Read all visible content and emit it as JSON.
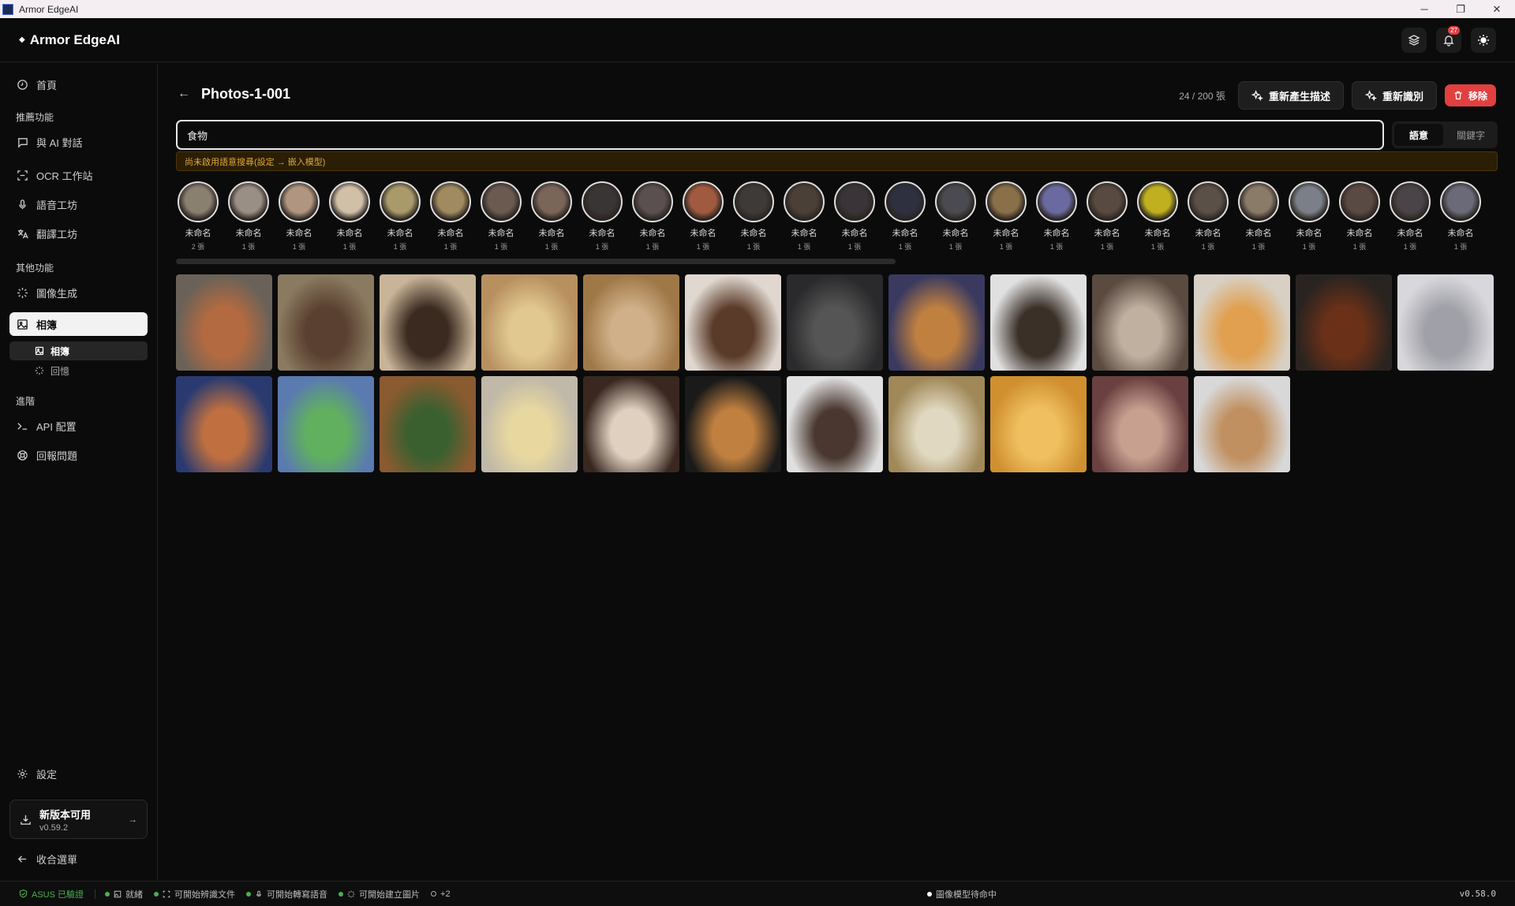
{
  "window": {
    "title": "Armor EdgeAI",
    "controls": [
      "─",
      "❐",
      "✕"
    ]
  },
  "header": {
    "brand": "Armor EdgeAI",
    "notification_count": "27"
  },
  "sidebar": {
    "home": "首頁",
    "section_recommended": "推薦功能",
    "chat": "與 AI 對話",
    "ocr": "OCR 工作站",
    "voice": "語音工坊",
    "translate": "翻譯工坊",
    "section_other": "其他功能",
    "image_gen": "圖像生成",
    "album": "相簿",
    "album_sub": "相簿",
    "memories_sub": "回憶",
    "section_advanced": "進階",
    "api": "API 配置",
    "report": "回報問題",
    "settings": "設定",
    "update_title": "新版本可用",
    "update_version": "v0.59.2",
    "collapse": "收合選單"
  },
  "main": {
    "title": "Photos-1-001",
    "count": "24 / 200 張",
    "regen_button": "重新產生描述",
    "rerecognize_button": "重新識別",
    "remove_button": "移除",
    "search_value": "食物",
    "mode_semantic": "語意",
    "mode_keyword": "關鍵字",
    "warning": "尚未啟用語意搜尋(設定 → 嵌入模型)"
  },
  "faces": [
    {
      "name": "未命名",
      "count": "2 張",
      "color": "#8a8070"
    },
    {
      "name": "未命名",
      "count": "1 張",
      "color": "#9a8f84"
    },
    {
      "name": "未命名",
      "count": "1 張",
      "color": "#b09580"
    },
    {
      "name": "未命名",
      "count": "1 張",
      "color": "#d0c0a8"
    },
    {
      "name": "未命名",
      "count": "1 張",
      "color": "#a89a6a"
    },
    {
      "name": "未命名",
      "count": "1 張",
      "color": "#a08a60"
    },
    {
      "name": "未命名",
      "count": "1 張",
      "color": "#6a5a50"
    },
    {
      "name": "未命名",
      "count": "1 張",
      "color": "#7a6658"
    },
    {
      "name": "未命名",
      "count": "1 張",
      "color": "#3a3535"
    },
    {
      "name": "未命名",
      "count": "1 張",
      "color": "#5a5050"
    },
    {
      "name": "未命名",
      "count": "1 張",
      "color": "#a05a40"
    },
    {
      "name": "未命名",
      "count": "1 張",
      "color": "#3e3a38"
    },
    {
      "name": "未命名",
      "count": "1 張",
      "color": "#4a4038"
    },
    {
      "name": "未命名",
      "count": "1 張",
      "color": "#3a3438"
    },
    {
      "name": "未命名",
      "count": "1 張",
      "color": "#2e3040"
    },
    {
      "name": "未命名",
      "count": "1 張",
      "color": "#4a4a50"
    },
    {
      "name": "未命名",
      "count": "1 張",
      "color": "#8a7048"
    },
    {
      "name": "未命名",
      "count": "1 張",
      "color": "#6a6aa0"
    },
    {
      "name": "未命名",
      "count": "1 張",
      "color": "#584a40"
    },
    {
      "name": "未命名",
      "count": "1 張",
      "color": "#c0b020"
    },
    {
      "name": "未命名",
      "count": "1 張",
      "color": "#5a5048"
    },
    {
      "name": "未命名",
      "count": "1 張",
      "color": "#8a7a68"
    },
    {
      "name": "未命名",
      "count": "1 張",
      "color": "#7a7f88"
    },
    {
      "name": "未命名",
      "count": "1 張",
      "color": "#5a4a44"
    },
    {
      "name": "未命名",
      "count": "1 張",
      "color": "#4a4448"
    },
    {
      "name": "未命名",
      "count": "1 張",
      "color": "#6a6a78"
    }
  ],
  "photos": [
    [
      "#6a6258",
      "#b46a40"
    ],
    [
      "#8a7a60",
      "#5a4030"
    ],
    [
      "#c8b498",
      "#3a2a20"
    ],
    [
      "#b89060",
      "#e0c890"
    ],
    [
      "#a07848",
      "#d0b088"
    ],
    [
      "#e0d8d0",
      "#5a3a28"
    ],
    [
      "#2a2a2c",
      "#555"
    ],
    [
      "#3a3a60",
      "#c08040"
    ],
    [
      "#e0e0e0",
      "#3a3028"
    ],
    [
      "#5a4a40",
      "#c0b0a0"
    ],
    [
      "#d8d0c4",
      "#e0a050"
    ],
    [
      "#2a2420",
      "#6a3018"
    ],
    [
      "#d8d8dc",
      "#a0a0a8"
    ],
    [
      "#2a3a70",
      "#c07040"
    ],
    [
      "#5a7ab0",
      "#60b060"
    ],
    [
      "#8a5a30",
      "#3a6030"
    ],
    [
      "#c0b8a8",
      "#e8d8a0"
    ],
    [
      "#3a2820",
      "#e0d0c0"
    ],
    [
      "#1a1a1a",
      "#c08040"
    ],
    [
      "#e0e0e0",
      "#4a3830"
    ],
    [
      "#a08858",
      "#e0d8c0"
    ],
    [
      "#d09030",
      "#f0c060"
    ],
    [
      "#6a4040",
      "#c8a090"
    ],
    [
      "#d8d8d8",
      "#c09060"
    ]
  ],
  "statusbar": {
    "verified": "ASUS 已驗證",
    "ready": "就緒",
    "doc": "可開始辨識文件",
    "speech": "可開始轉寫語音",
    "image": "可開始建立圖片",
    "more": "+2",
    "model": "圖像模型待命中",
    "version": "v0.58.0"
  }
}
